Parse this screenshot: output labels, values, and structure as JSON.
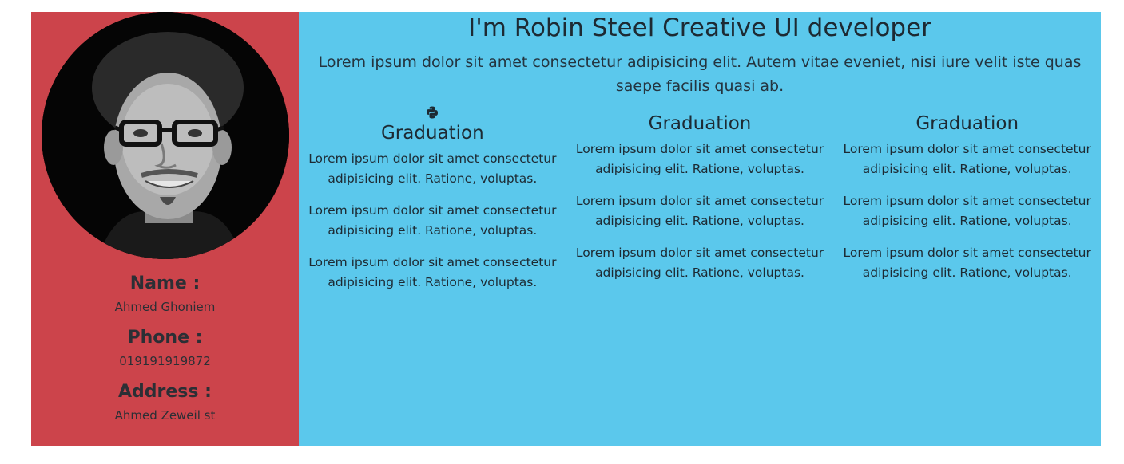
{
  "profile": {
    "name_label": "Name :",
    "name_value": "Ahmed Ghoniem",
    "phone_label": "Phone :",
    "phone_value": "019191919872",
    "address_label": "Address :",
    "address_value": "Ahmed Zeweil st"
  },
  "hero": {
    "title": "I'm Robin Steel Creative UI developer",
    "intro": "Lorem ipsum dolor sit amet consectetur adipisicing elit. Autem vitae eveniet, nisi iure velit iste quas saepe facilis quasi ab."
  },
  "columns": [
    {
      "icon": "python-icon",
      "title": "Graduation",
      "paragraphs": [
        "Lorem ipsum dolor sit amet consectetur adipisicing elit. Ratione, voluptas.",
        "Lorem ipsum dolor sit amet consectetur adipisicing elit. Ratione, voluptas.",
        "Lorem ipsum dolor sit amet consectetur adipisicing elit. Ratione, voluptas."
      ]
    },
    {
      "title": "Graduation",
      "paragraphs": [
        "Lorem ipsum dolor sit amet consectetur adipisicing elit. Ratione, voluptas.",
        "Lorem ipsum dolor sit amet consectetur adipisicing elit. Ratione, voluptas.",
        "Lorem ipsum dolor sit amet consectetur adipisicing elit. Ratione, voluptas."
      ]
    },
    {
      "title": "Graduation",
      "paragraphs": [
        "Lorem ipsum dolor sit amet consectetur adipisicing elit. Ratione, voluptas.",
        "Lorem ipsum dolor sit amet consectetur adipisicing elit. Ratione, voluptas.",
        "Lorem ipsum dolor sit amet consectetur adipisicing elit. Ratione, voluptas."
      ]
    }
  ],
  "colors": {
    "sidebar_bg": "#cc444b",
    "main_bg": "#5bc8ec"
  }
}
